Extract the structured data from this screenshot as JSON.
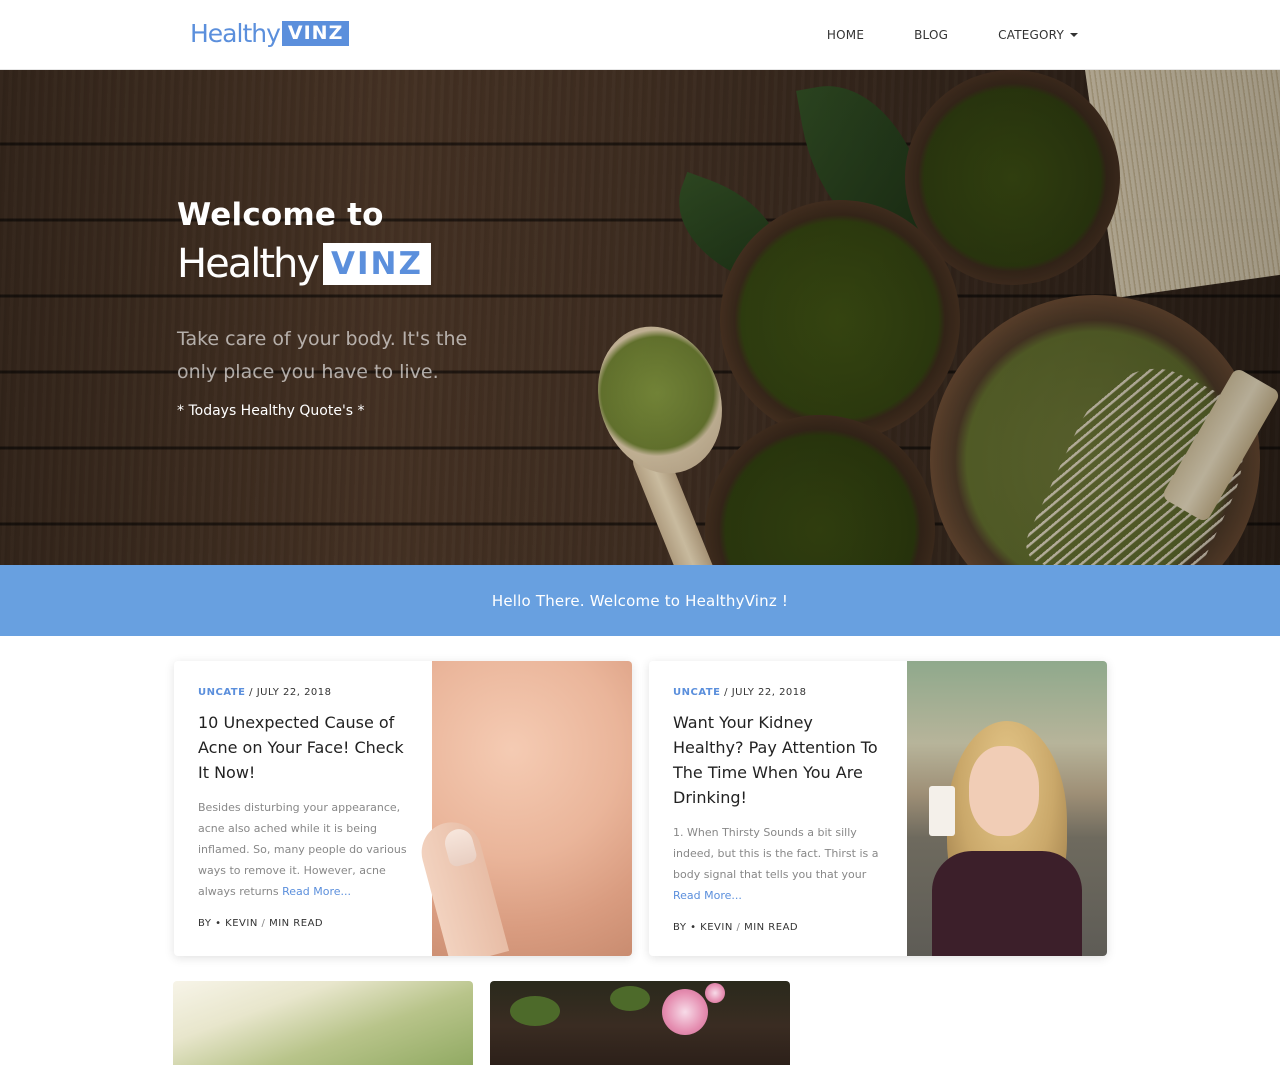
{
  "header": {
    "logo_text": "Healthy",
    "logo_box": "VINZ",
    "nav": [
      {
        "label": "HOME"
      },
      {
        "label": "BLOG"
      },
      {
        "label": "CATEGORY"
      }
    ]
  },
  "hero": {
    "welcome": "Welcome to",
    "logo_text": "Healthy",
    "logo_box": "VINZ",
    "tagline": "Take care of your body. It's the only place you have to live.",
    "quote_label": "* Todays Healthy Quote's *"
  },
  "banner": {
    "text": "Hello There. Welcome to HealthyVinz !"
  },
  "posts": [
    {
      "category": "UNCATE",
      "date": "/ JULY 22, 2018",
      "title": "10 Unexpected Cause of Acne on Your Face! Check It Now!",
      "excerpt": "Besides disturbing your appearance, acne also ached while it is being inflamed. So, many people do various ways to remove it. However, acne always returns",
      "read_more": "Read More...",
      "author": "BY • KEVIN",
      "sep": " / ",
      "read_time": "MIN READ"
    },
    {
      "category": "UNCATE",
      "date": "/ JULY 22, 2018",
      "title": "Want Your Kidney Healthy? Pay Attention To The Time When You Are Drinking!",
      "excerpt": "1. When Thirsty   Sounds a bit silly indeed, but this is the fact. Thirst is a body signal that tells you that your",
      "read_more": "Read More...",
      "author": "BY • KEVIN",
      "sep": " / ",
      "read_time": "MIN READ"
    }
  ]
}
